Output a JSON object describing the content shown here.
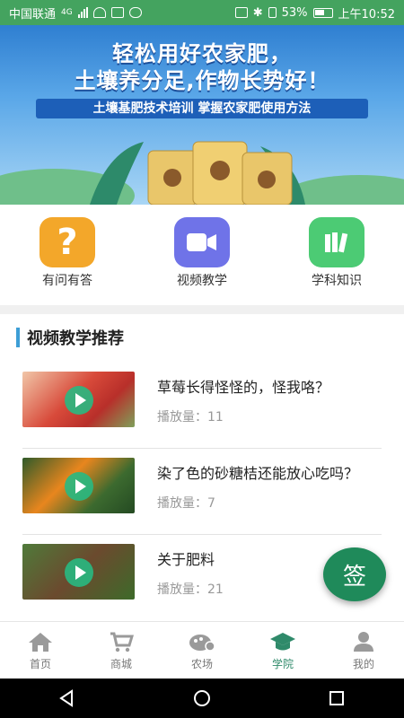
{
  "status_bar": {
    "carrier": "中国联通",
    "network": "4G",
    "battery": "53%",
    "time": "上午10:52"
  },
  "banner": {
    "headline_1": "轻松用好农家肥，",
    "headline_2": "土壤养分足,作物长势好！",
    "subtitle": "土壤基肥技术培训  掌握农家肥使用方法"
  },
  "quick_menu": [
    {
      "label": "有问有答",
      "icon": "question-icon",
      "color": "#f3a72a"
    },
    {
      "label": "视频教学",
      "icon": "video-camera-icon",
      "color": "#6f73e8"
    },
    {
      "label": "学科知识",
      "icon": "books-icon",
      "color": "#4ccb74"
    }
  ],
  "section": {
    "title": "视频教学推荐"
  },
  "videos": [
    {
      "title": "草莓长得怪怪的，怪我咯？",
      "plays": "播放量：11"
    },
    {
      "title": "染了色的砂糖桔还能放心吃吗？",
      "plays": "播放量：7"
    },
    {
      "title": "关于肥料",
      "plays": "播放量：21"
    }
  ],
  "fab": {
    "label": "签"
  },
  "bottom_nav": [
    {
      "label": "首页",
      "icon": "home-icon"
    },
    {
      "label": "商城",
      "icon": "cart-icon"
    },
    {
      "label": "农场",
      "icon": "farm-icon"
    },
    {
      "label": "学院",
      "icon": "academy-icon",
      "active": true
    },
    {
      "label": "我的",
      "icon": "profile-icon"
    }
  ],
  "colors": {
    "accent": "#2f8a6a",
    "fab": "#1f8a5a",
    "section_bar": "#3d9ed6"
  }
}
